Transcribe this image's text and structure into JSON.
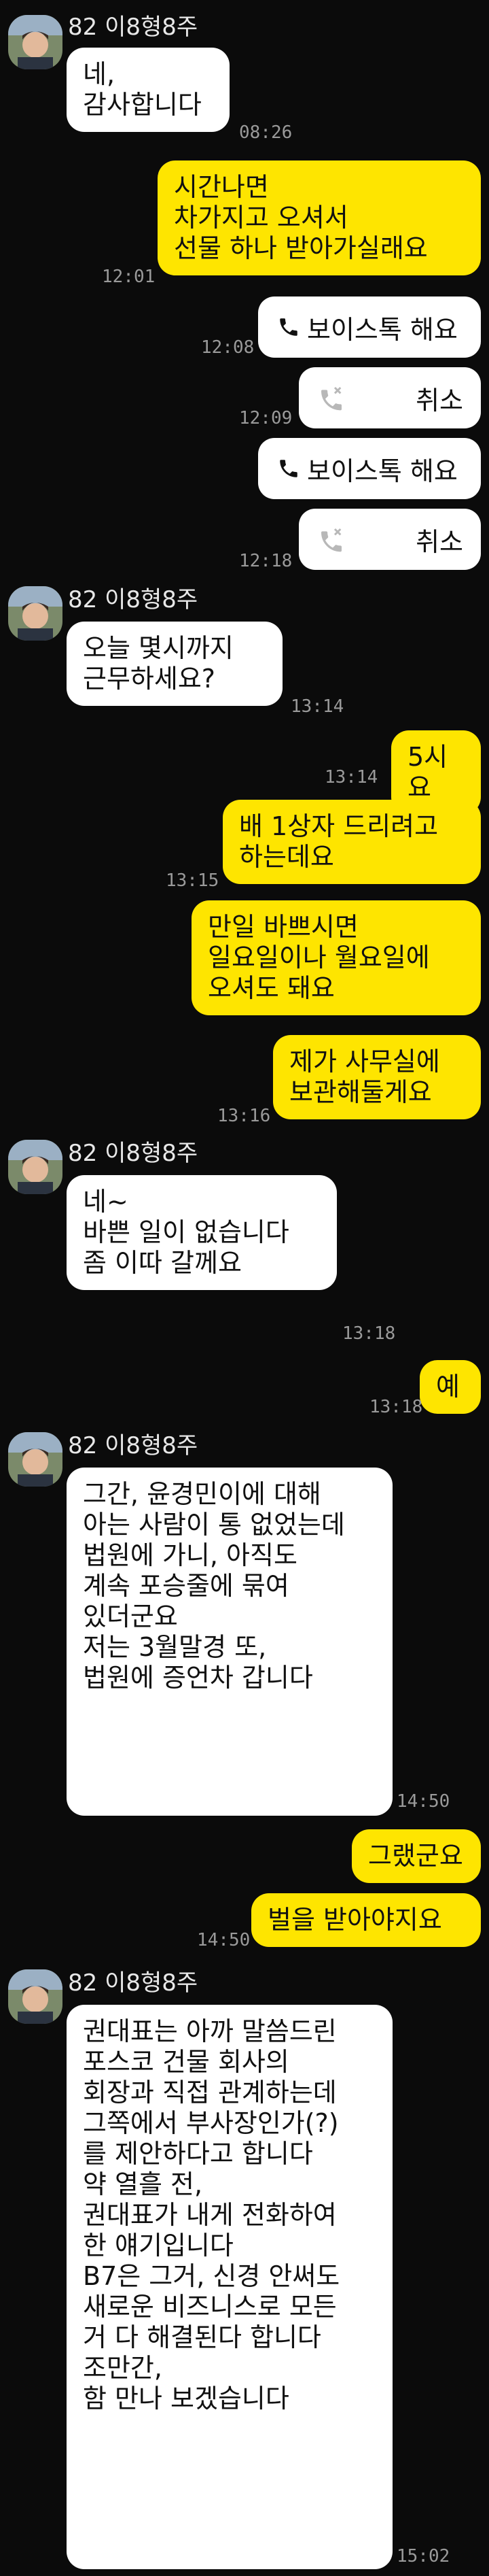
{
  "contact": {
    "name": "82 이8형8주"
  },
  "messages": {
    "m1": {
      "text": "네,\n감사합니다",
      "time": "08:26"
    },
    "m2": {
      "text": "시간나면\n 차가지고 오셔서\n 선물 하나 받아가실래요",
      "time": "12:01"
    },
    "c1": {
      "text": "보이스톡 해요",
      "time": "12:08",
      "icon": "phone-icon"
    },
    "c2": {
      "text": "취소",
      "time": "12:09",
      "icon": "missed-call-icon"
    },
    "c3": {
      "text": "보이스톡 해요",
      "icon": "phone-icon"
    },
    "c4": {
      "text": "취소",
      "time": "12:18",
      "icon": "missed-call-icon"
    },
    "m3": {
      "text": "오늘 몇시까지\n근무하세요?",
      "time": "13:14"
    },
    "m4": {
      "text": "5시요",
      "time": "13:14"
    },
    "m5": {
      "text": "배 1상자 드리려고\n하는데요",
      "time": "13:15"
    },
    "m6": {
      "text": "만일 바쁘시면\n일요일이나 월요일에\n오셔도 돼요"
    },
    "m7": {
      "text": "제가 사무실에\n보관해둘게요",
      "time": "13:16"
    },
    "m8": {
      "text": "네~\n바쁜 일이 없습니다\n좀 이따 갈께요",
      "time": "13:18"
    },
    "m9": {
      "text": "예",
      "time": "13:18"
    },
    "m10": {
      "text": "그간, 윤경민이에 대해\n아는 사람이 통 없었는데\n법원에 가니, 아직도\n계속 포승줄에 묶여\n있더군요\n저는 3월말경 또,\n법원에 증언차 갑니다",
      "time": "14:50"
    },
    "m11": {
      "text": "그랬군요"
    },
    "m12": {
      "text": "벌을 받아야지요",
      "time": "14:50"
    },
    "m13": {
      "text": "권대표는 아까 말씀드린\n포스코 건물 회사의\n회장과 직접 관계하는데\n그쪽에서 부사장인가(?)\n를 제안하다고 합니다\n약 열흘 전,\n권대표가 내게 전화하여\n한 얘기입니다\nB7은 그거, 신경 안써도\n새로운 비즈니스로 모든\n거 다 해결된다 합니다\n조만간,\n함 만나 보겠습니다",
      "time": "15:02"
    }
  },
  "colors": {
    "background": "#0b0b0b",
    "incoming": "#ffffff",
    "outgoing": "#fee500",
    "timestamp": "#9a9a9a"
  }
}
